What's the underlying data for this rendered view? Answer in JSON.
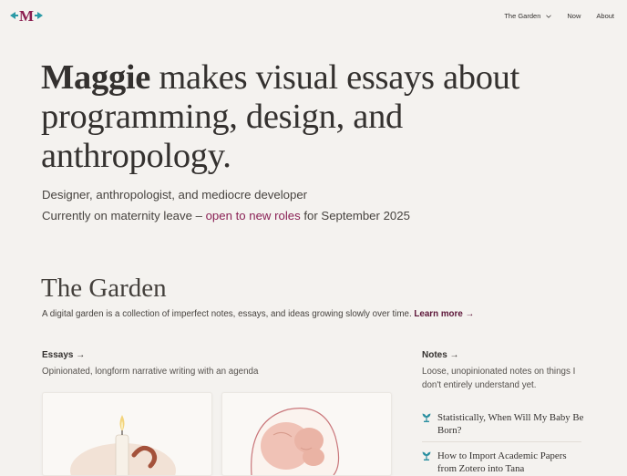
{
  "header": {
    "logo_letter": "M",
    "nav": {
      "garden": "The Garden",
      "now": "Now",
      "about": "About"
    }
  },
  "hero": {
    "name": "Maggie",
    "headline_rest": " makes visual essays about programming, design, and anthropology.",
    "tagline": "Designer, anthropologist, and mediocre developer",
    "status_prefix": "Currently on maternity leave – ",
    "status_link": "open to new roles",
    "status_suffix": " for September 2025"
  },
  "garden": {
    "title": "The Garden",
    "description": "A digital garden is a collection of imperfect notes, essays, and ideas growing slowly over time. ",
    "learn_more": "Learn more →"
  },
  "essays": {
    "label": "Essays →",
    "description": "Opinionated, longform narrative writing with an agenda"
  },
  "notes": {
    "label": "Notes →",
    "description_line1": "Loose, unopinionated notes on things I",
    "description_line2": "don't entirely understand yet.",
    "items": [
      {
        "title_line1": "Statistically, When Will My Baby Be",
        "title_line2": "Born?"
      },
      {
        "title_line1": "How to Import Academic Papers",
        "title_line2": "from Zotero into Tana"
      }
    ]
  },
  "colors": {
    "background": "#f4f2ef",
    "text": "#34312f",
    "link": "#8a2155",
    "logo_magenta": "#8a1d4f",
    "logo_teal": "#2a9aa6"
  },
  "icons": [
    "logo-icon",
    "chevron-down-icon",
    "sprout-icon",
    "candle-illustration",
    "baby-illustration"
  ]
}
